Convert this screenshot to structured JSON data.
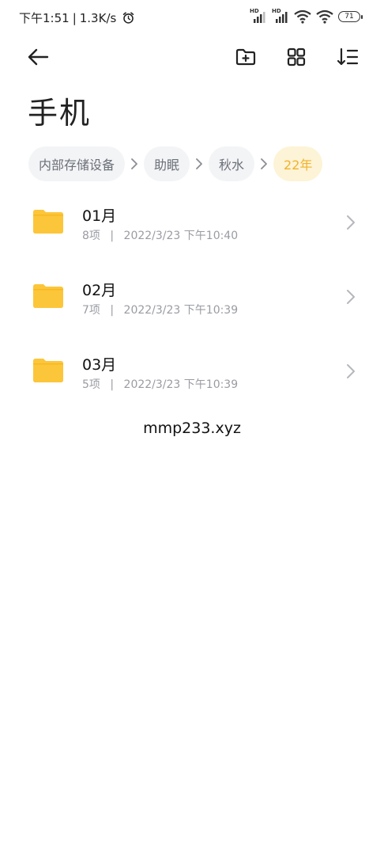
{
  "status_bar": {
    "time": "下午1:51",
    "separator": "|",
    "net_speed": "1.3K/s",
    "signal1_label": "HD",
    "signal2_label": "HD",
    "battery": "71"
  },
  "toolbar": {
    "back_icon": "arrow-left-icon",
    "new_folder_icon": "folder-plus-icon",
    "grid_icon": "grid-view-icon",
    "sort_icon": "sort-icon"
  },
  "page": {
    "title": "手机"
  },
  "breadcrumb": [
    {
      "label": "内部存储设备"
    },
    {
      "label": "助眠"
    },
    {
      "label": "秋水"
    },
    {
      "label": "22年"
    }
  ],
  "folders": [
    {
      "name": "01月",
      "count": "8项",
      "date": "2022/3/23 下午10:40"
    },
    {
      "name": "02月",
      "count": "7项",
      "date": "2022/3/23 下午10:39"
    },
    {
      "name": "03月",
      "count": "5项",
      "date": "2022/3/23 下午10:39"
    }
  ],
  "meta_separator": "|",
  "watermark": "mmp233.xyz",
  "colors": {
    "folder": "#fcc63a",
    "active_crumb_bg": "#fdf3d6",
    "active_crumb_text": "#f0b32a",
    "crumb_bg": "#f3f4f6"
  }
}
